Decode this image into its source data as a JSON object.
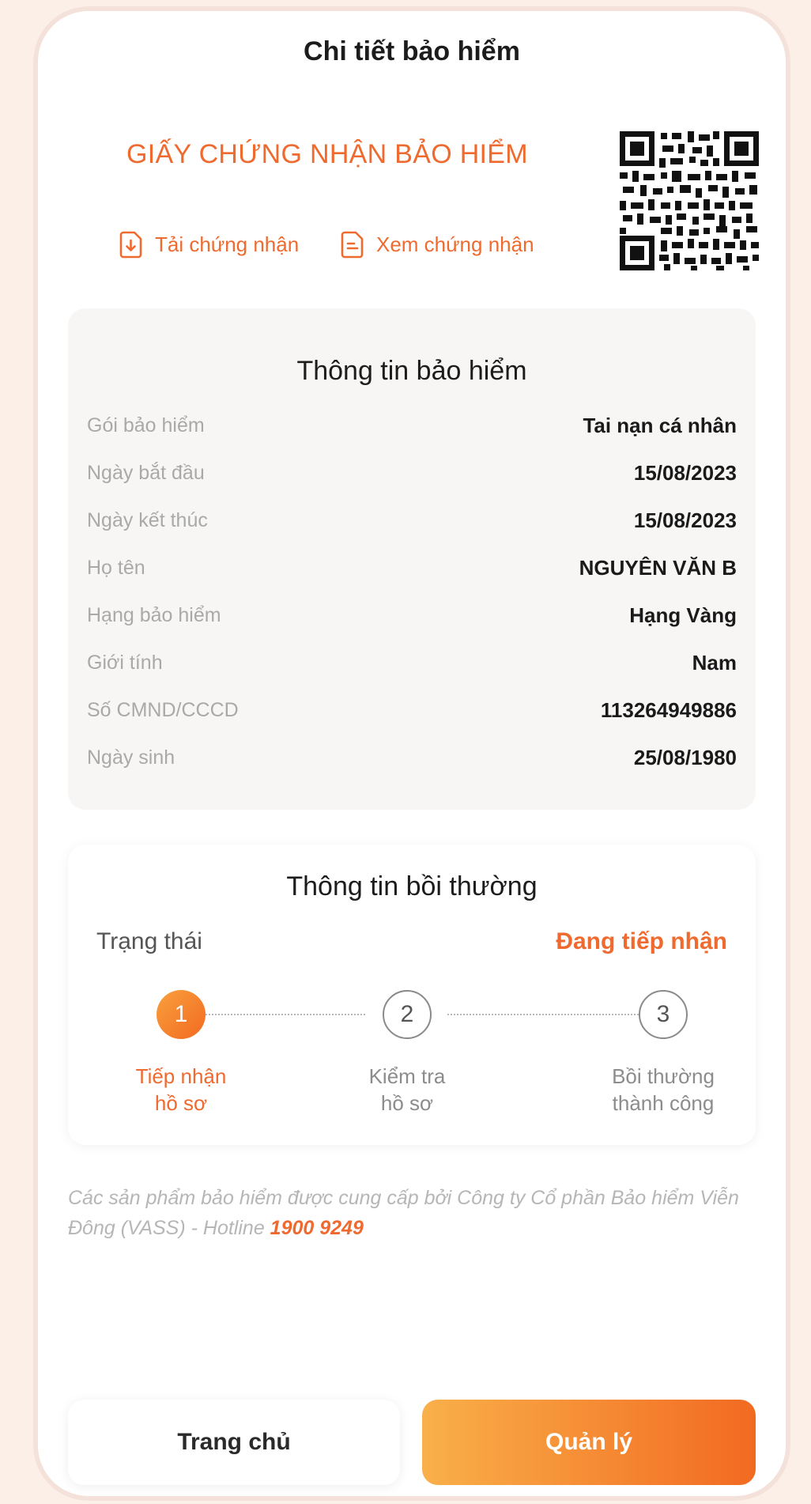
{
  "header": {
    "title": "Chi tiết bảo hiểm"
  },
  "certificate": {
    "title": "GIẤY CHỨNG NHẬN BẢO HIỂM",
    "download_label": "Tải chứng nhận",
    "view_label": "Xem chứng nhận"
  },
  "insurance_info": {
    "title": "Thông tin bảo hiểm",
    "rows": [
      {
        "label": "Gói bảo hiểm",
        "value": "Tai nạn cá nhân"
      },
      {
        "label": "Ngày bắt đầu",
        "value": "15/08/2023"
      },
      {
        "label": "Ngày kết thúc",
        "value": "15/08/2023"
      },
      {
        "label": "Họ tên",
        "value": "NGUYÊN VĂN B"
      },
      {
        "label": "Hạng bảo hiểm",
        "value": "Hạng Vàng"
      },
      {
        "label": "Giới tính",
        "value": "Nam"
      },
      {
        "label": "Số CMND/CCCD",
        "value": "113264949886"
      },
      {
        "label": "Ngày sinh",
        "value": "25/08/1980"
      }
    ]
  },
  "claim_info": {
    "title": "Thông tin bồi thường",
    "status_label": "Trạng thái",
    "status_value": "Đang tiếp nhận",
    "steps": [
      {
        "number": "1",
        "line1": "Tiếp nhận",
        "line2": "hồ sơ"
      },
      {
        "number": "2",
        "line1": "Kiểm tra",
        "line2": "hồ sơ"
      },
      {
        "number": "3",
        "line1": "Bồi thường",
        "line2": "thành công"
      }
    ]
  },
  "footnote": {
    "text": "Các sản phẩm bảo hiểm được cung cấp bởi Công ty Cổ phần Bảo hiểm Viễn Đông (VASS) - Hotline ",
    "hotline": "1900 9249"
  },
  "buttons": {
    "home_label": "Trang chủ",
    "manage_label": "Quản lý"
  },
  "colors": {
    "accent": "#ef6a2f",
    "background": "#fcefe8"
  },
  "icons": {
    "download": "download-file-icon",
    "view": "document-icon",
    "qr": "qr-code"
  }
}
